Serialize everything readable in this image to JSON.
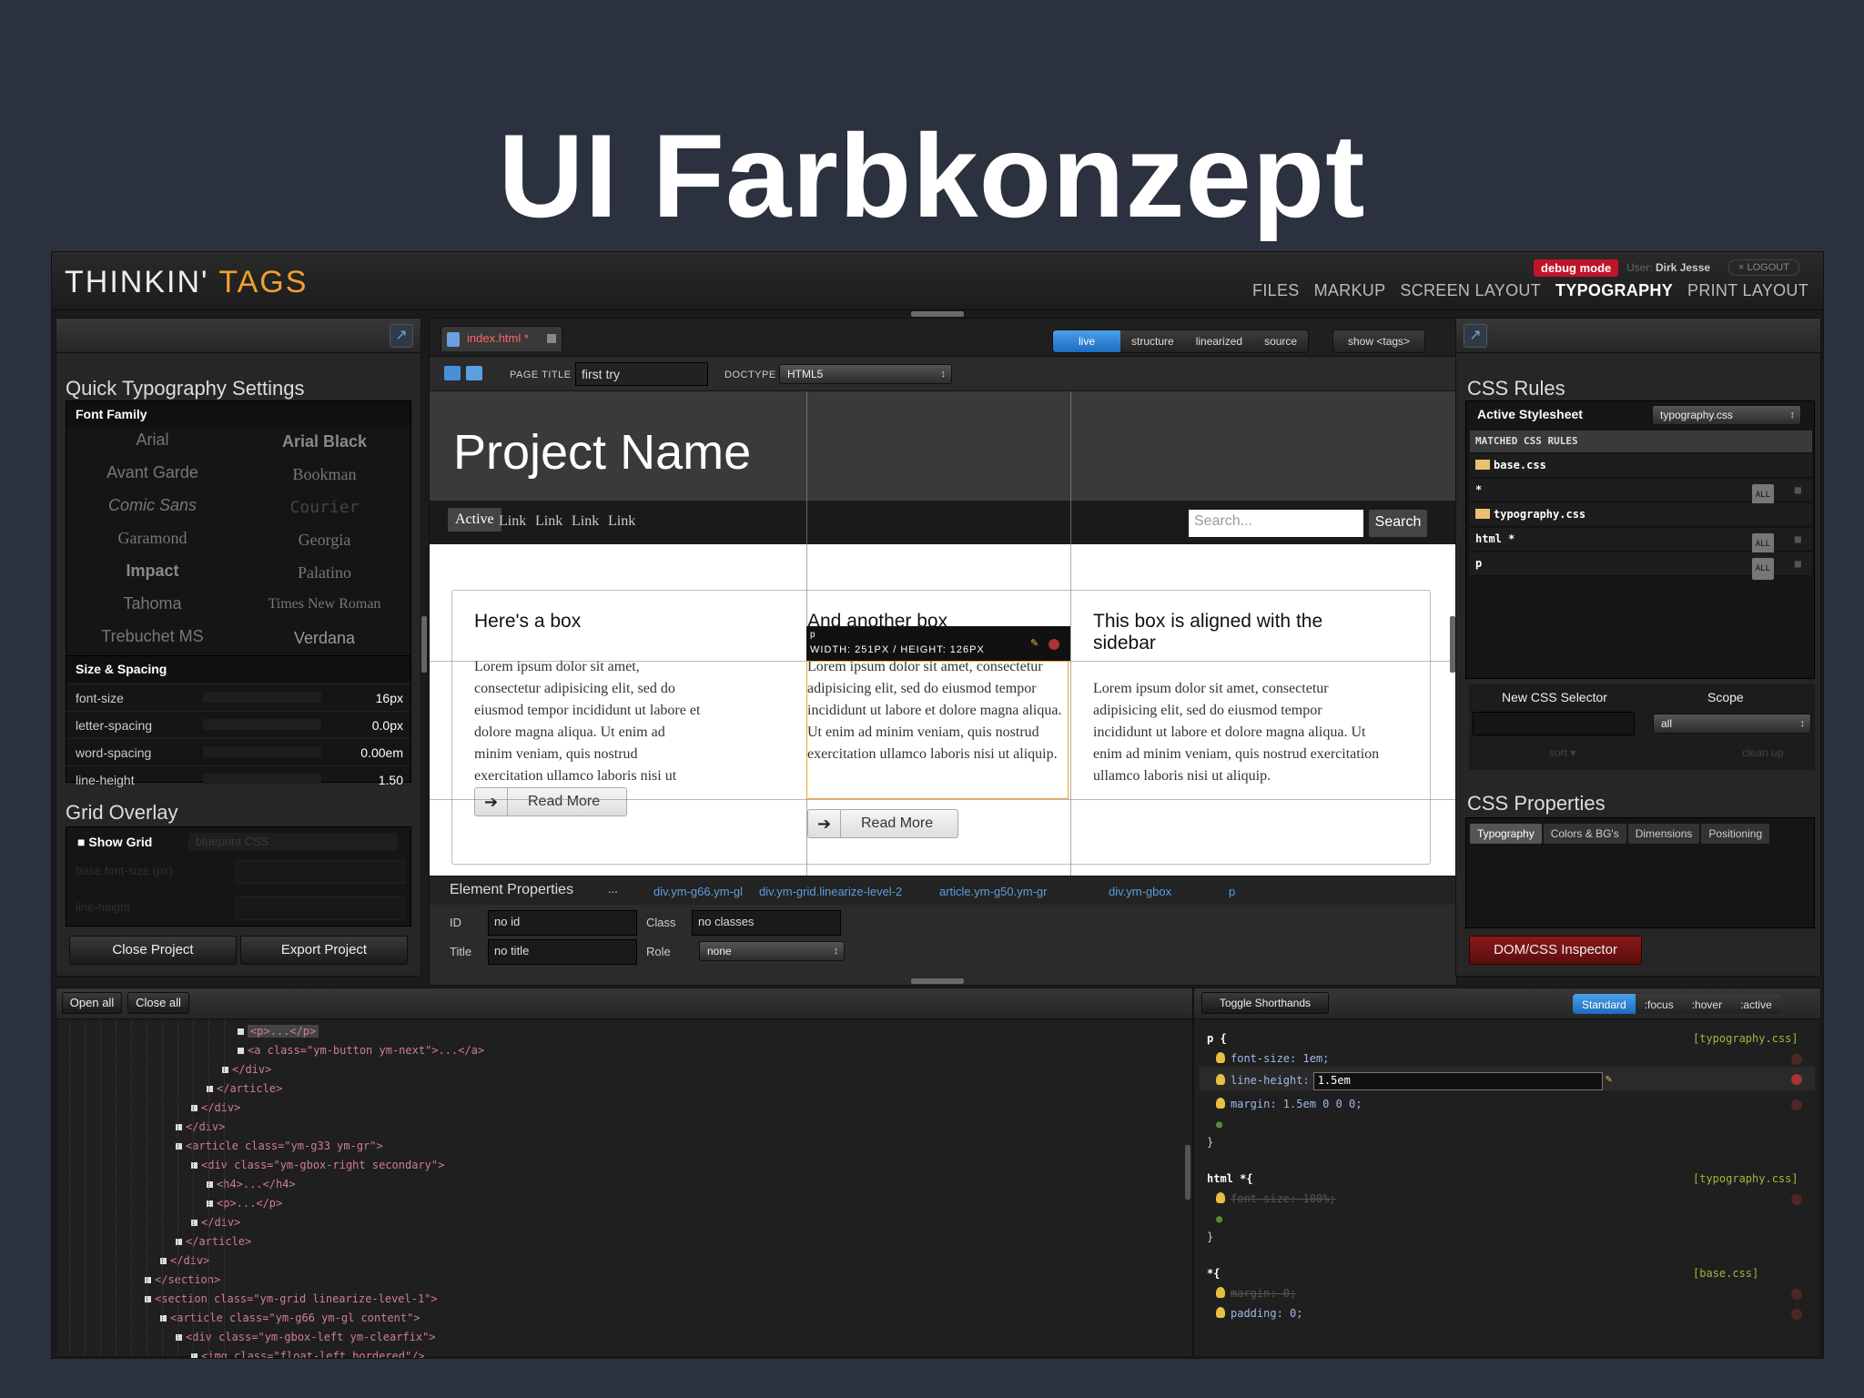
{
  "slide": {
    "title": "UI Farbkonzept"
  },
  "app": {
    "logo": "THINKIN'",
    "logo_accent": "TAGS",
    "debug": "debug mode",
    "user_label": "User:",
    "user_name": "Dirk Jesse",
    "logout": "× LOGOUT",
    "nav": [
      "FILES",
      "MARKUP",
      "SCREEN LAYOUT",
      "TYPOGRAPHY",
      "PRINT LAYOUT"
    ],
    "nav_active": "TYPOGRAPHY"
  },
  "left": {
    "quick_title": "Quick Typography Settings",
    "font_family_label": "Font Family",
    "fonts_left": [
      "Arial",
      "Avant Garde",
      "Comic Sans",
      "Garamond",
      "Impact",
      "Tahoma",
      "Trebuchet MS"
    ],
    "fonts_right": [
      "Arial Black",
      "Bookman",
      "Courier",
      "Georgia",
      "Palatino",
      "Times New Roman",
      "Verdana"
    ],
    "size_spacing_label": "Size & Spacing",
    "settings": [
      {
        "label": "font-size",
        "value": "16px"
      },
      {
        "label": "letter-spacing",
        "value": "0.0px"
      },
      {
        "label": "word-spacing",
        "value": "0.00em"
      },
      {
        "label": "line-height",
        "value": "1.50"
      }
    ],
    "grid_title": "Grid Overlay",
    "show_grid": "Show Grid",
    "grid_select": "blueprint CSS",
    "grid_fields": [
      "base font-size (px)",
      "line-height"
    ],
    "close_project": "Close Project",
    "export_project": "Export Project"
  },
  "center": {
    "tab_label": "index.html *",
    "modes": [
      "live",
      "structure",
      "linearized",
      "source"
    ],
    "mode_active": "live",
    "show_tags": "show <tags>",
    "page_title_label": "PAGE TITLE",
    "page_title_value": "first try",
    "doctype_label": "DOCTYPE",
    "doctype_value": "HTML5",
    "preview": {
      "project_name": "Project Name",
      "nav": [
        "Active",
        "Link",
        "Link",
        "Link",
        "Link"
      ],
      "search_placeholder": "Search...",
      "search_button": "Search",
      "col1_title": "Here's a box",
      "col2_title": "And another box",
      "col3_title": "This box is aligned with the sidebar",
      "lorem": "Lorem ipsum dolor sit amet, consectetur adipisicing elit, sed do eiusmod tempor incididunt ut labore et dolore magna aliqua. Ut enim ad minim veniam, quis nostrud exercitation ullamco laboris nisi ut aliquip.",
      "read_more": "Read More",
      "tip_tag": "p",
      "tip_dims": "WIDTH: 251PX / HEIGHT: 126PX"
    },
    "element_props": {
      "title": "Element Properties",
      "ellipsis": "...",
      "crumbs": [
        "div.ym-g66.ym-gl",
        "div.ym-grid.linearize-level-2",
        "article.ym-g50.ym-gr",
        "div.ym-gbox",
        "p"
      ],
      "id_label": "ID",
      "id_value": "no id",
      "class_label": "Class",
      "class_value": "no classes",
      "title_label": "Title",
      "title_value": "no title",
      "role_label": "Role",
      "role_value": "none"
    }
  },
  "right": {
    "css_rules_title": "CSS Rules",
    "active_stylesheet_label": "Active Stylesheet",
    "active_stylesheet_value": "typography.css",
    "matched_label": "MATCHED CSS RULES",
    "rules": [
      {
        "text": "base.css",
        "kind": "file"
      },
      {
        "text": "*",
        "kind": "rule"
      },
      {
        "text": "typography.css",
        "kind": "file"
      },
      {
        "text": "html *",
        "kind": "rule"
      },
      {
        "text": "p",
        "kind": "rule"
      }
    ],
    "all_badge": "ALL",
    "new_selector_label": "New CSS Selector",
    "scope_label": "Scope",
    "scope_value": "all",
    "sort": "sort ▾",
    "clean_up": "clean up",
    "css_props_title": "CSS Properties",
    "prop_tabs": [
      "Typography",
      "Colors & BG's",
      "Dimensions",
      "Positioning"
    ],
    "inspector_button": "DOM/CSS Inspector"
  },
  "bottom_left": {
    "open_all": "Open all",
    "close_all": "Close all",
    "tree": [
      {
        "indent": 11,
        "html": "<p>...</p>"
      },
      {
        "indent": 11,
        "html": "<a class=\"ym-button ym-next\">...</a>"
      },
      {
        "indent": 10,
        "html": "</div>"
      },
      {
        "indent": 9,
        "html": "</article>"
      },
      {
        "indent": 8,
        "html": "</div>"
      },
      {
        "indent": 7,
        "html": "</div>"
      },
      {
        "indent": 7,
        "html": "<article class=\"ym-g33 ym-gr\">"
      },
      {
        "indent": 8,
        "html": "<div class=\"ym-gbox-right secondary\">"
      },
      {
        "indent": 9,
        "html": "<h4>...</h4>"
      },
      {
        "indent": 9,
        "html": "<p>...</p>"
      },
      {
        "indent": 8,
        "html": "</div>"
      },
      {
        "indent": 7,
        "html": "</article>"
      },
      {
        "indent": 6,
        "html": "</div>"
      },
      {
        "indent": 5,
        "html": "</section>"
      },
      {
        "indent": 5,
        "html": "<section class=\"ym-grid linearize-level-1\">"
      },
      {
        "indent": 6,
        "html": "<article class=\"ym-g66 ym-gl content\">"
      },
      {
        "indent": 7,
        "html": "<div class=\"ym-gbox-left ym-clearfix\">"
      },
      {
        "indent": 8,
        "html": "<img class=\"float-left bordered\"/>"
      }
    ]
  },
  "bottom_right": {
    "toggle": "Toggle Shorthands",
    "states": [
      "Standard",
      ":focus",
      ":hover",
      ":active"
    ],
    "state_active": "Standard",
    "blocks": [
      {
        "selector": "p {",
        "source": "[typography.css]",
        "props": [
          {
            "text": "font-size: 1em;",
            "strike": false
          },
          {
            "text": "line-height:",
            "value": "1.5em",
            "editing": true
          },
          {
            "text": "margin: 1.5em 0 0 0;",
            "strike": false
          }
        ]
      },
      {
        "selector": "html *{",
        "source": "[typography.css]",
        "props": [
          {
            "text": "font-size: 100%;",
            "strike": true
          }
        ]
      },
      {
        "selector": "*{",
        "source": "[base.css]",
        "props": [
          {
            "text": "margin: 0;",
            "strike": true
          },
          {
            "text": "padding: 0;",
            "strike": false
          }
        ]
      }
    ],
    "close_brace": "}"
  }
}
